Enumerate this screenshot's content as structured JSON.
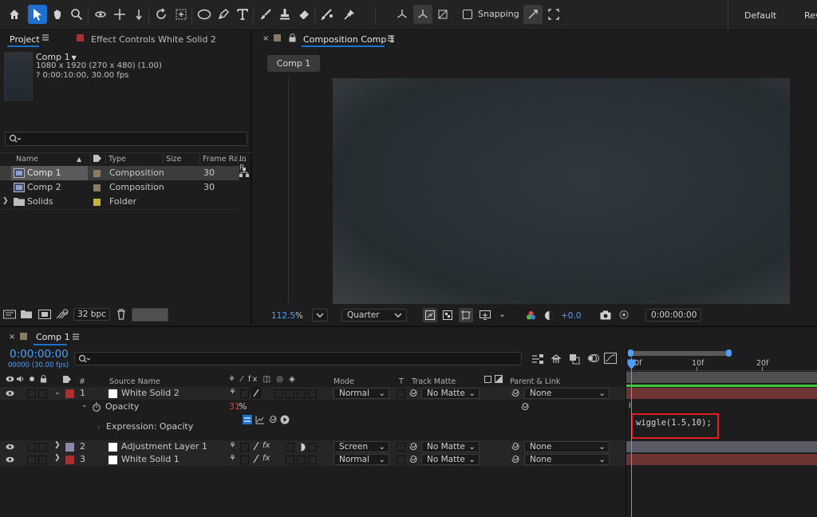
{
  "toolbar": {
    "snapping_label": "Snapping",
    "workspace_default": "Default",
    "workspace_review": "Rev"
  },
  "project_panel": {
    "tab_project": "Project",
    "tab_effect_controls": "Effect Controls White Solid 2",
    "selected": {
      "name": "Comp 1",
      "resolution": "1080 x 1920  (270 x 480) (1.00)",
      "duration": "? 0:00:10:00, 30.00 fps"
    },
    "columns": [
      "Name",
      "Type",
      "Size",
      "Frame Ra...",
      "In P"
    ],
    "items": [
      {
        "name": "Comp 1",
        "type": "Composition",
        "frame_rate": "30",
        "label_color": "#8a7a60"
      },
      {
        "name": "Comp 2",
        "type": "Composition",
        "frame_rate": "30",
        "label_color": "#8a7a60"
      },
      {
        "name": "Solids",
        "type": "Folder",
        "frame_rate": "",
        "label_color": "#c8b43c"
      }
    ],
    "bpc": "32 bpc"
  },
  "comp_panel": {
    "tab_title": "Composition Comp 1",
    "sub_tab": "Comp 1",
    "zoom": "112.5",
    "zoom_unit": "%",
    "resolution": "Quarter",
    "exposure": "+0.0",
    "timecode": "0:00:00:00"
  },
  "timeline": {
    "tab_title": "Comp 1",
    "timecode": "0:00:00:00",
    "frames": "00000 (30.00 fps)",
    "columns": {
      "number": "#",
      "source_name": "Source Name",
      "mode": "Mode",
      "t": "T",
      "track_matte": "Track Matte",
      "parent_link": "Parent & Link"
    },
    "ruler": [
      "0f",
      "10f",
      "20f"
    ],
    "layers": [
      {
        "num": "1",
        "name": "White Solid 2",
        "mode": "Normal",
        "matte": "No Matte",
        "parent": "None",
        "label_color": "#a83232"
      },
      {
        "num": "2",
        "name": "Adjustment Layer 1",
        "mode": "Screen",
        "matte": "No Matte",
        "parent": "None",
        "label_color": "#8a8aa8"
      },
      {
        "num": "3",
        "name": "White Solid 1",
        "mode": "Normal",
        "matte": "No Matte",
        "parent": "None",
        "label_color": "#a83232"
      }
    ],
    "property": {
      "name": "Opacity",
      "value": "31",
      "unit": "%",
      "expression_label": "Expression: Opacity",
      "expression_text": "wiggle(1.5,10);"
    }
  },
  "colors": {
    "accent": "#1f6fd1",
    "timecode_blue": "#4d9fff",
    "solid_track": "#6e3434",
    "adj_track": "#5a5a66",
    "expression_box": "#e01e1e"
  }
}
